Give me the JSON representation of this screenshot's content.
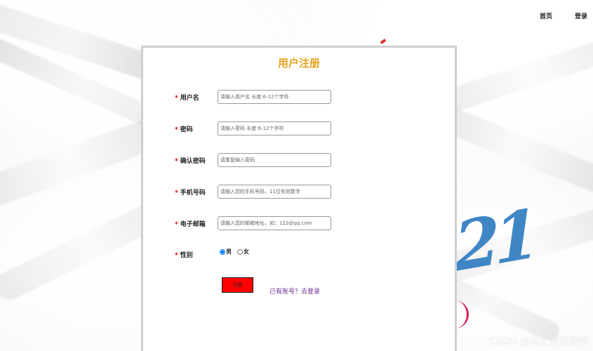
{
  "nav": {
    "home": "首页",
    "login": "登录"
  },
  "form": {
    "title": "用户注册",
    "required_mark": "*",
    "username_label": "用户名",
    "username_placeholder": "请输入用户名 长度:6-12个字符",
    "password_label": "密码",
    "password_placeholder": "请输入密码 长度:6-12个字符",
    "confirm_label": "确认密码",
    "confirm_placeholder": "请重复输入密码",
    "phone_label": "手机号码",
    "phone_placeholder": "请输入您的手机号码，11位有效数字",
    "email_label": "电子邮箱",
    "email_placeholder": "请输入您的邮箱地址，如：123@qq.com",
    "gender_label": "性别",
    "gender_options": [
      "男",
      "女"
    ],
    "selected_gender": "男",
    "submit_label": "注册",
    "login_link": "已有账号？去登录"
  },
  "decor": {
    "number_text": "21"
  },
  "watermark": "CSDN @仙女网页制作",
  "colors": {
    "title": "#e6a11b",
    "required": "#e00000",
    "submit_bg": "#ff0000",
    "link": "#6a2c8f",
    "decor_blue": "#3f86c5"
  }
}
